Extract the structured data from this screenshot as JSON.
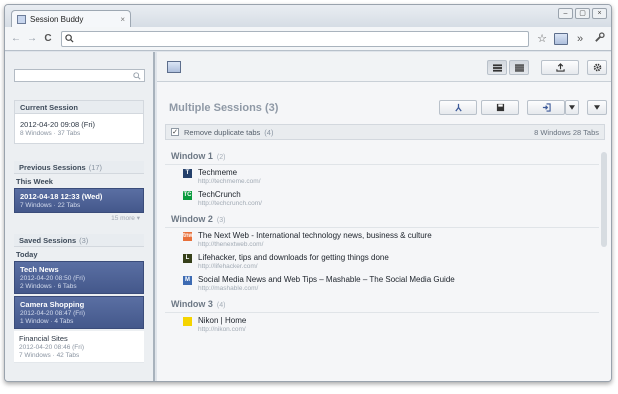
{
  "browser": {
    "tab_title": "Session Buddy",
    "tab_close": "×",
    "window_buttons": [
      "–",
      "▢",
      "×"
    ],
    "nav": {
      "back": "←",
      "forward": "→",
      "reload": "C"
    },
    "omnibox_value": "",
    "toolbar_overflow": "»",
    "wrench": "🔧",
    "star": "☆"
  },
  "sidebar": {
    "search_placeholder": "",
    "current": {
      "heading": "Current Session",
      "items": [
        {
          "title": "2012-04-20 09:08 (Fri)",
          "meta": "8 Windows · 37 Tabs"
        }
      ]
    },
    "previous": {
      "heading": "Previous Sessions",
      "count": "(17)",
      "group": "This Week",
      "items": [
        {
          "title": "2012-04-18 12:33 (Wed)",
          "meta": "7 Windows · 22 Tabs"
        }
      ],
      "more": "15 more ▾"
    },
    "saved": {
      "heading": "Saved Sessions",
      "count": "(3)",
      "group": "Today",
      "items": [
        {
          "title": "Tech News",
          "date": "2012-04-20 08:50 (Fri)",
          "meta": "2 Windows · 6 Tabs"
        },
        {
          "title": "Camera Shopping",
          "date": "2012-04-20 08:47 (Fri)",
          "meta": "1 Window · 4 Tabs"
        },
        {
          "title": "Financial Sites",
          "date": "2012-04-20 08:46 (Fri)",
          "meta": "7 Windows · 42 Tabs"
        }
      ]
    }
  },
  "main": {
    "heading": "Multiple Sessions (3)",
    "dedupe_label": "Remove duplicate tabs",
    "dedupe_count": "(4)",
    "dedupe_checked": "✓",
    "stats": "8 Windows   28 Tabs",
    "windows": [
      {
        "title": "Window 1",
        "count": "(2)",
        "tabs": [
          {
            "title": "Techmeme",
            "url": "http://techmeme.com/",
            "icon": "techmeme-icon",
            "color": "#24406b",
            "glyph": "T"
          },
          {
            "title": "TechCrunch",
            "url": "http://techcrunch.com/",
            "icon": "techcrunch-icon",
            "color": "#0a9b3e",
            "glyph": "TC"
          }
        ]
      },
      {
        "title": "Window 2",
        "count": "(3)",
        "tabs": [
          {
            "title": "The Next Web - International technology news, business & culture",
            "url": "http://thenextweb.com/",
            "icon": "thenextweb-icon",
            "color": "#e8703a",
            "glyph": "tnw"
          },
          {
            "title": "Lifehacker, tips and downloads for getting things done",
            "url": "http://lifehacker.com/",
            "icon": "lifehacker-icon",
            "color": "#36401a",
            "glyph": "L"
          },
          {
            "title": "Social Media News and Web Tips – Mashable – The Social Media Guide",
            "url": "http://mashable.com/",
            "icon": "mashable-icon",
            "color": "#3d6bb3",
            "glyph": "M"
          }
        ]
      },
      {
        "title": "Window 3",
        "count": "(4)",
        "tabs": [
          {
            "title": "Nikon | Home",
            "url": "http://nikon.com/",
            "icon": "nikon-icon",
            "color": "#f5d400",
            "glyph": ""
          }
        ]
      }
    ]
  }
}
